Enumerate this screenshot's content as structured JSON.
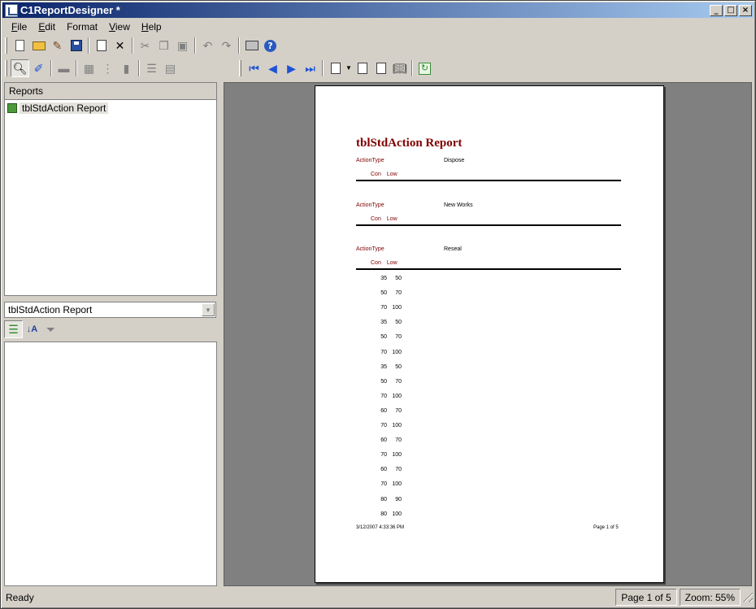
{
  "window": {
    "title": "C1ReportDesigner *"
  },
  "menu": [
    {
      "u": "F",
      "rest": "ile"
    },
    {
      "u": "E",
      "rest": "dit"
    },
    {
      "u": "",
      "pre": "F",
      "rest": "ormat",
      "label": "Format"
    },
    {
      "u": "V",
      "rest": "iew"
    },
    {
      "u": "H",
      "rest": "elp"
    }
  ],
  "menu_labels": [
    "File",
    "Edit",
    "Format",
    "View",
    "Help"
  ],
  "reports_panel": {
    "header": "Reports",
    "items": [
      "tblStdAction Report"
    ]
  },
  "properties": {
    "selected_object": "tblStdAction Report"
  },
  "report": {
    "title": "tblStdAction Report",
    "group_label": "ActionType",
    "col_con": "Con",
    "col_low": "Low",
    "groups": [
      {
        "value": "Dispose",
        "rows": []
      },
      {
        "value": "New Works",
        "rows": []
      },
      {
        "value": "Reseal",
        "rows": [
          [
            "35",
            "50"
          ],
          [
            "50",
            "70"
          ],
          [
            "70",
            "100"
          ],
          [
            "35",
            "50"
          ],
          [
            "50",
            "70"
          ],
          [
            "70",
            "100"
          ],
          [
            "35",
            "50"
          ],
          [
            "50",
            "70"
          ],
          [
            "70",
            "100"
          ],
          [
            "60",
            "70"
          ],
          [
            "70",
            "100"
          ],
          [
            "60",
            "70"
          ],
          [
            "70",
            "100"
          ],
          [
            "60",
            "70"
          ],
          [
            "70",
            "100"
          ],
          [
            "80",
            "90"
          ],
          [
            "80",
            "100"
          ]
        ]
      }
    ],
    "footer_date": "3/12/2007 4:33:36 PM",
    "footer_page": "Page 1 of 5"
  },
  "status": {
    "text": "Ready",
    "page": "Page 1 of 5",
    "zoom": "Zoom: 55%"
  }
}
